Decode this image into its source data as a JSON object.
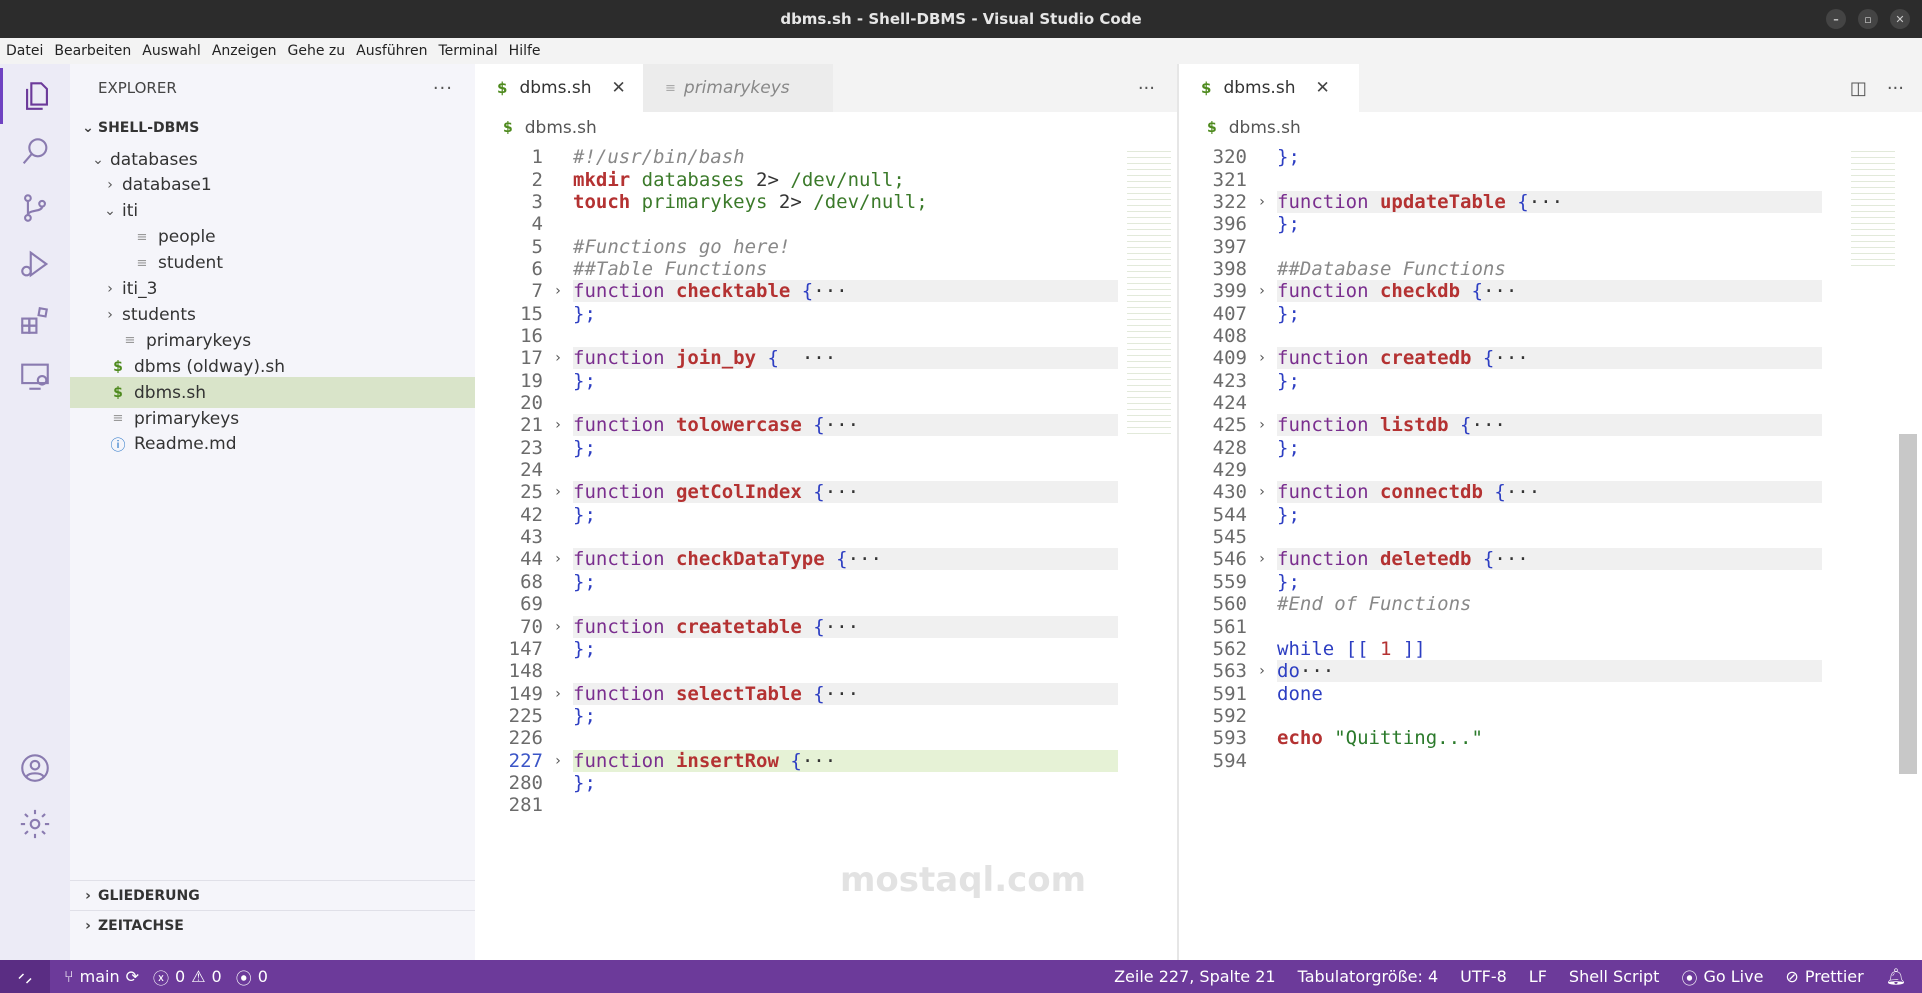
{
  "window": {
    "title": "dbms.sh - Shell-DBMS - Visual Studio Code"
  },
  "menu": [
    "Datei",
    "Bearbeiten",
    "Auswahl",
    "Anzeigen",
    "Gehe zu",
    "Ausführen",
    "Terminal",
    "Hilfe"
  ],
  "activity": [
    "explorer-icon",
    "search-icon",
    "source-control-icon",
    "run-debug-icon",
    "extensions-icon",
    "remote-explorer-icon",
    "account-icon",
    "settings-gear-icon"
  ],
  "sidebar": {
    "title": "EXPLORER",
    "root": "SHELL-DBMS",
    "tree": [
      {
        "label": "databases",
        "depth": 1,
        "kind": "folder-open"
      },
      {
        "label": "database1",
        "depth": 2,
        "kind": "folder"
      },
      {
        "label": "iti",
        "depth": 2,
        "kind": "folder-open"
      },
      {
        "label": "people",
        "depth": 3,
        "kind": "file"
      },
      {
        "label": "student",
        "depth": 3,
        "kind": "file"
      },
      {
        "label": "iti_3",
        "depth": 2,
        "kind": "folder"
      },
      {
        "label": "students",
        "depth": 2,
        "kind": "folder"
      },
      {
        "label": "primarykeys",
        "depth": 2,
        "kind": "file"
      },
      {
        "label": "dbms (oldway).sh",
        "depth": 1,
        "kind": "shell"
      },
      {
        "label": "dbms.sh",
        "depth": 1,
        "kind": "shell",
        "selected": true
      },
      {
        "label": "primarykeys",
        "depth": 1,
        "kind": "file"
      },
      {
        "label": "Readme.md",
        "depth": 1,
        "kind": "info"
      }
    ],
    "outline": "GLIEDERUNG",
    "timeline": "ZEITACHSE"
  },
  "left_editor": {
    "tabs": [
      {
        "label": "dbms.sh",
        "active": true
      },
      {
        "label": "primarykeys",
        "active": false
      }
    ],
    "breadcrumb": "dbms.sh",
    "lines": [
      {
        "n": "1",
        "tokens": [
          [
            "#!/usr/bin/bash",
            "com"
          ]
        ]
      },
      {
        "n": "2",
        "tokens": [
          [
            "mkdir",
            "cmd"
          ],
          [
            " databases ",
            "arg"
          ],
          [
            "2> ",
            "plain"
          ],
          [
            "/dev/null;",
            "arg"
          ]
        ]
      },
      {
        "n": "3",
        "tokens": [
          [
            "touch",
            "cmd"
          ],
          [
            " primarykeys ",
            "arg"
          ],
          [
            "2> ",
            "plain"
          ],
          [
            "/dev/null;",
            "arg"
          ]
        ]
      },
      {
        "n": "4",
        "tokens": []
      },
      {
        "n": "5",
        "tokens": [
          [
            "#Functions go here!",
            "com"
          ]
        ]
      },
      {
        "n": "6",
        "tokens": [
          [
            "##Table Functions",
            "com"
          ]
        ]
      },
      {
        "n": "7",
        "fold": true,
        "tokens": [
          [
            "function",
            "kw"
          ],
          [
            " ",
            "plain"
          ],
          [
            "checktable",
            "fn"
          ],
          [
            " {",
            "brace"
          ],
          [
            "···",
            "ellip"
          ]
        ]
      },
      {
        "n": "15",
        "tokens": [
          [
            "};",
            "brace"
          ]
        ]
      },
      {
        "n": "16",
        "tokens": []
      },
      {
        "n": "17",
        "fold": true,
        "tokens": [
          [
            "function",
            "kw"
          ],
          [
            " ",
            "plain"
          ],
          [
            "join_by",
            "fn"
          ],
          [
            " {  ",
            "brace"
          ],
          [
            "···",
            "ellip"
          ]
        ]
      },
      {
        "n": "19",
        "tokens": [
          [
            "};",
            "brace"
          ]
        ]
      },
      {
        "n": "20",
        "tokens": []
      },
      {
        "n": "21",
        "fold": true,
        "tokens": [
          [
            "function",
            "kw"
          ],
          [
            " ",
            "plain"
          ],
          [
            "tolowercase",
            "fn"
          ],
          [
            " {",
            "brace"
          ],
          [
            "···",
            "ellip"
          ]
        ]
      },
      {
        "n": "23",
        "tokens": [
          [
            "};",
            "brace"
          ]
        ]
      },
      {
        "n": "24",
        "tokens": []
      },
      {
        "n": "25",
        "fold": true,
        "tokens": [
          [
            "function",
            "kw"
          ],
          [
            " ",
            "plain"
          ],
          [
            "getColIndex",
            "fn"
          ],
          [
            " {",
            "brace"
          ],
          [
            "···",
            "ellip"
          ]
        ]
      },
      {
        "n": "42",
        "tokens": [
          [
            "};",
            "brace"
          ]
        ]
      },
      {
        "n": "43",
        "tokens": []
      },
      {
        "n": "44",
        "fold": true,
        "tokens": [
          [
            "function",
            "kw"
          ],
          [
            " ",
            "plain"
          ],
          [
            "checkDataType",
            "fn"
          ],
          [
            " {",
            "brace"
          ],
          [
            "···",
            "ellip"
          ]
        ]
      },
      {
        "n": "68",
        "tokens": [
          [
            "};",
            "brace"
          ]
        ]
      },
      {
        "n": "69",
        "tokens": []
      },
      {
        "n": "70",
        "fold": true,
        "tokens": [
          [
            "function",
            "kw"
          ],
          [
            " ",
            "plain"
          ],
          [
            "createtable",
            "fn"
          ],
          [
            " {",
            "brace"
          ],
          [
            "···",
            "ellip"
          ]
        ]
      },
      {
        "n": "147",
        "tokens": [
          [
            "};",
            "brace"
          ]
        ]
      },
      {
        "n": "148",
        "tokens": []
      },
      {
        "n": "149",
        "fold": true,
        "tokens": [
          [
            "function",
            "kw"
          ],
          [
            " ",
            "plain"
          ],
          [
            "selectTable",
            "fn"
          ],
          [
            " {",
            "brace"
          ],
          [
            "···",
            "ellip"
          ]
        ]
      },
      {
        "n": "225",
        "tokens": [
          [
            "};",
            "brace"
          ]
        ]
      },
      {
        "n": "226",
        "tokens": []
      },
      {
        "n": "227",
        "fold": true,
        "current": true,
        "tokens": [
          [
            "function",
            "kw"
          ],
          [
            " ",
            "plain"
          ],
          [
            "insertRow",
            "fn"
          ],
          [
            " {",
            "brace"
          ],
          [
            "···",
            "ellip"
          ]
        ]
      },
      {
        "n": "280",
        "tokens": [
          [
            "};",
            "brace"
          ]
        ]
      },
      {
        "n": "281",
        "tokens": []
      }
    ]
  },
  "right_editor": {
    "tabs": [
      {
        "label": "dbms.sh",
        "active": true
      }
    ],
    "breadcrumb": "dbms.sh",
    "lines": [
      {
        "n": "320",
        "tokens": [
          [
            "};",
            "brace"
          ]
        ]
      },
      {
        "n": "321",
        "tokens": []
      },
      {
        "n": "322",
        "fold": true,
        "tokens": [
          [
            "function",
            "kw"
          ],
          [
            " ",
            "plain"
          ],
          [
            "updateTable",
            "fn"
          ],
          [
            " {",
            "brace"
          ],
          [
            "···",
            "ellip"
          ]
        ]
      },
      {
        "n": "396",
        "tokens": [
          [
            "};",
            "brace"
          ]
        ]
      },
      {
        "n": "397",
        "tokens": []
      },
      {
        "n": "398",
        "tokens": [
          [
            "##Database Functions",
            "com"
          ]
        ]
      },
      {
        "n": "399",
        "fold": true,
        "tokens": [
          [
            "function",
            "kw"
          ],
          [
            " ",
            "plain"
          ],
          [
            "checkdb",
            "fn"
          ],
          [
            " {",
            "brace"
          ],
          [
            "···",
            "ellip"
          ]
        ]
      },
      {
        "n": "407",
        "tokens": [
          [
            "};",
            "brace"
          ]
        ]
      },
      {
        "n": "408",
        "tokens": []
      },
      {
        "n": "409",
        "fold": true,
        "tokens": [
          [
            "function",
            "kw"
          ],
          [
            " ",
            "plain"
          ],
          [
            "createdb",
            "fn"
          ],
          [
            " {",
            "brace"
          ],
          [
            "···",
            "ellip"
          ]
        ]
      },
      {
        "n": "423",
        "tokens": [
          [
            "};",
            "brace"
          ]
        ]
      },
      {
        "n": "424",
        "tokens": []
      },
      {
        "n": "425",
        "fold": true,
        "tokens": [
          [
            "function",
            "kw"
          ],
          [
            " ",
            "plain"
          ],
          [
            "listdb",
            "fn"
          ],
          [
            " {",
            "brace"
          ],
          [
            "···",
            "ellip"
          ]
        ]
      },
      {
        "n": "428",
        "tokens": [
          [
            "};",
            "brace"
          ]
        ]
      },
      {
        "n": "429",
        "tokens": []
      },
      {
        "n": "430",
        "fold": true,
        "tokens": [
          [
            "function",
            "kw"
          ],
          [
            " ",
            "plain"
          ],
          [
            "connectdb",
            "fn"
          ],
          [
            " {",
            "brace"
          ],
          [
            "···",
            "ellip"
          ]
        ]
      },
      {
        "n": "544",
        "tokens": [
          [
            "};",
            "brace"
          ]
        ]
      },
      {
        "n": "545",
        "tokens": []
      },
      {
        "n": "546",
        "fold": true,
        "tokens": [
          [
            "function",
            "kw"
          ],
          [
            " ",
            "plain"
          ],
          [
            "deletedb",
            "fn"
          ],
          [
            " {",
            "brace"
          ],
          [
            "···",
            "ellip"
          ]
        ]
      },
      {
        "n": "559",
        "tokens": [
          [
            "};",
            "brace"
          ]
        ]
      },
      {
        "n": "560",
        "tokens": [
          [
            "#End of Functions",
            "com"
          ]
        ]
      },
      {
        "n": "561",
        "tokens": []
      },
      {
        "n": "562",
        "tokens": [
          [
            "while",
            "blue"
          ],
          [
            " [[ ",
            "brace"
          ],
          [
            "1",
            "num"
          ],
          [
            " ]]",
            "brace"
          ]
        ]
      },
      {
        "n": "563",
        "fold": true,
        "tokens": [
          [
            "do",
            "blue"
          ],
          [
            "···",
            "ellip"
          ]
        ]
      },
      {
        "n": "591",
        "tokens": [
          [
            "done",
            "blue"
          ]
        ]
      },
      {
        "n": "592",
        "tokens": []
      },
      {
        "n": "593",
        "tokens": [
          [
            "echo",
            "cmd"
          ],
          [
            " ",
            "plain"
          ],
          [
            "\"Quitting...\"",
            "str"
          ]
        ]
      },
      {
        "n": "594",
        "tokens": []
      }
    ]
  },
  "watermark": "mostaql.com",
  "status": {
    "branch": "main",
    "errors": "0",
    "warnings": "0",
    "ports": "0",
    "position": "Zeile 227, Spalte 21",
    "tab_size": "Tabulatorgröße: 4",
    "encoding": "UTF-8",
    "eol": "LF",
    "language": "Shell Script",
    "live": "Go Live",
    "prettier": "Prettier"
  },
  "colors": {
    "accent": "#6c3a9a",
    "selection": "#d9e4c9",
    "function_name": "#b43232",
    "keyword": "#7a2e8e"
  }
}
